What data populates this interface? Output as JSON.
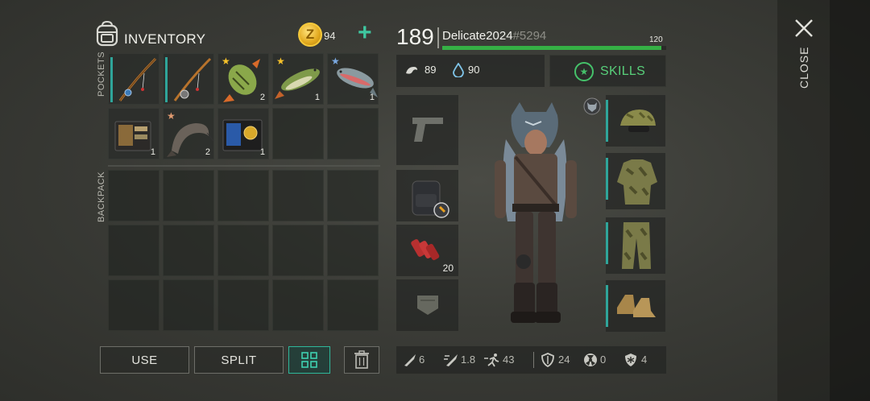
{
  "inventory": {
    "title": "INVENTORY",
    "coins": "94",
    "pockets_label": "POCKETS",
    "backpack_label": "BACKPACK",
    "pockets": [
      {
        "item": "fishing-rod",
        "count": ""
      },
      {
        "item": "fishing-rod",
        "count": ""
      },
      {
        "item": "perch-fish",
        "count": "2",
        "star": "gold"
      },
      {
        "item": "pike-fish",
        "count": "1",
        "star": "gold"
      },
      {
        "item": "trout-fish",
        "count": "1",
        "star": "blue"
      },
      {
        "item": "wallet",
        "count": "1"
      },
      {
        "item": "catfish",
        "count": "2",
        "star": "bronze"
      },
      {
        "item": "police-badge",
        "count": "1"
      },
      {
        "item": "",
        "count": ""
      },
      {
        "item": "",
        "count": ""
      }
    ]
  },
  "buttons": {
    "use": "USE",
    "split": "SPLIT"
  },
  "player": {
    "level": "189",
    "name": "Delicate2024",
    "tag": "#5294",
    "xp_max": "120",
    "xp_fraction": 0.98,
    "hunger": "89",
    "thirst": "90",
    "skills_label": "SKILLS"
  },
  "equipment": {
    "ammo_count": "20"
  },
  "char_stats": {
    "melee": "6",
    "attack_speed": "1.8",
    "move_speed": "43",
    "armor": "24",
    "radiation": "0",
    "cold": "4"
  },
  "close_label": "CLOSE",
  "colors": {
    "accent": "#2fb79a",
    "xp": "#35b045",
    "skills": "#58cf7a"
  }
}
